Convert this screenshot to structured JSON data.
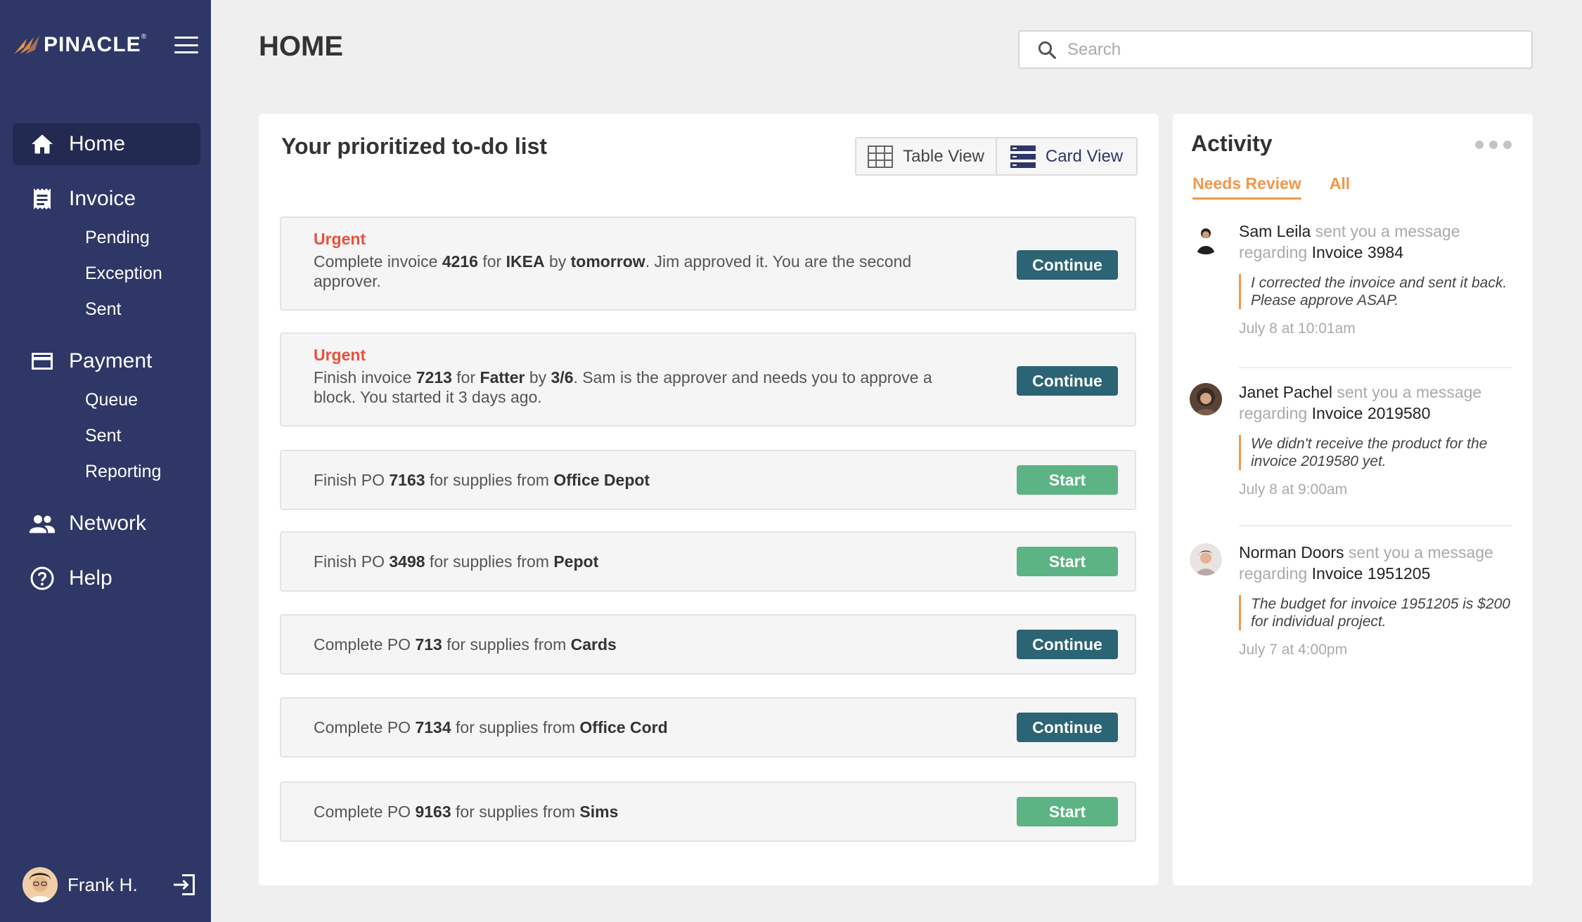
{
  "brand": {
    "name": "PINACLE",
    "mark": "®"
  },
  "sidebar": {
    "items": [
      {
        "label": "Home",
        "icon": "home-icon",
        "sub": []
      },
      {
        "label": "Invoice",
        "icon": "invoice-icon",
        "sub": [
          "Pending",
          "Exception",
          "Sent"
        ]
      },
      {
        "label": "Payment",
        "icon": "credit-card-icon",
        "sub": [
          "Queue",
          "Sent",
          "Reporting"
        ]
      },
      {
        "label": "Network",
        "icon": "people-icon",
        "sub": []
      },
      {
        "label": "Help",
        "icon": "help-icon",
        "sub": []
      }
    ],
    "user": {
      "name": "Frank H."
    }
  },
  "header": {
    "title": "HOME",
    "search_placeholder": "Search"
  },
  "todo": {
    "title": "Your prioritized to-do list",
    "views": {
      "table": "Table View",
      "card": "Card View"
    },
    "tasks": [
      {
        "urgent": "Urgent",
        "text1": "Complete invoice ",
        "b1": "4216",
        "text2": " for ",
        "b2": "IKEA",
        "text3": " by ",
        "b3": "tomorrow",
        "text4": ". Jim approved it. You are the second approver.",
        "action": "Continue"
      },
      {
        "urgent": "Urgent",
        "text1": "Finish invoice ",
        "b1": "7213",
        "text2": " for ",
        "b2": "Fatter",
        "text3": " by ",
        "b3": "3/6",
        "text4": ". Sam is the approver and needs you to approve a block. You started it 3 days ago.",
        "action": "Continue"
      },
      {
        "text1": "Finish PO ",
        "b1": "7163",
        "text2": " for supplies from ",
        "b2": "Office Depot",
        "action": "Start"
      },
      {
        "text1": "Finish PO ",
        "b1": "3498",
        "text2": " for supplies from ",
        "b2": "Pepot",
        "action": "Start"
      },
      {
        "text1": "Complete PO ",
        "b1": "713",
        "text2": " for supplies from ",
        "b2": "Cards",
        "action": "Continue"
      },
      {
        "text1": "Complete PO ",
        "b1": "7134",
        "text2": " for supplies from ",
        "b2": "Office Cord",
        "action": "Continue"
      },
      {
        "text1": "Complete PO ",
        "b1": "9163",
        "text2": " for supplies from ",
        "b2": "Sims",
        "action": "Start"
      }
    ]
  },
  "activity": {
    "title": "Activity",
    "tabs": [
      "Needs Review",
      "All"
    ],
    "messages": [
      {
        "name": "Sam Leila",
        "mid": " sent you a message regarding ",
        "invoice": "Invoice 3984",
        "quote": "I corrected the invoice and sent it back. Please approve ASAP.",
        "time": "July 8 at 10:01am"
      },
      {
        "name": "Janet Pachel",
        "mid": " sent you a message regarding ",
        "invoice": "Invoice 2019580",
        "quote": "We didn't receive the product for the invoice 2019580 yet.",
        "time": "July 8 at 9:00am"
      },
      {
        "name": "Norman Doors",
        "mid": " sent you a message regarding ",
        "invoice": "Invoice 1951205",
        "quote": "The budget for invoice 1951205 is $200 for individual project.",
        "time": "July 7 at 4:00pm"
      }
    ]
  },
  "colors": {
    "sidebar": "#2e3766",
    "sidebar_active": "#232a52",
    "urgent": "#e8513d",
    "continue": "#2b6474",
    "start": "#5cb384",
    "accent": "#f1974a"
  }
}
